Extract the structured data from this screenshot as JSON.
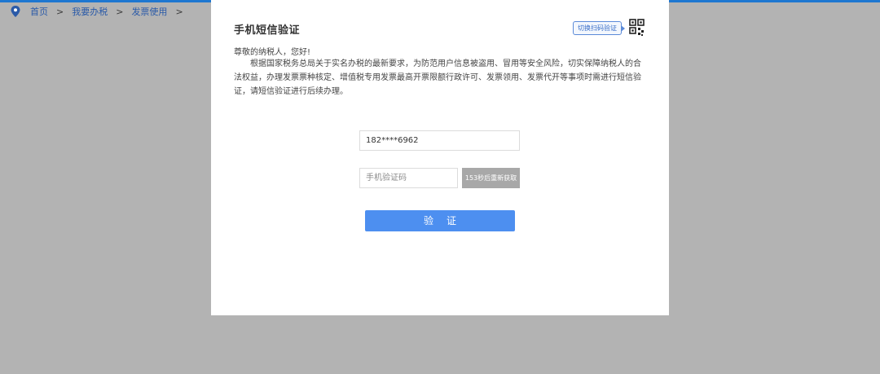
{
  "breadcrumb": {
    "items": [
      "首页",
      "我要办税",
      "发票使用"
    ],
    "separator": ">"
  },
  "modal": {
    "title": "手机短信验证",
    "switch_label": "切换扫码验证",
    "greeting": "尊敬的纳税人，您好!",
    "notice": "根据国家税务总局关于实名办税的最新要求，为防范用户信息被盗用、冒用等安全风险，切实保障纳税人的合法权益，办理发票票种核定、增值税专用发票最高开票限额行政许可、发票领用、发票代开等事项时需进行短信验证，请短信验证进行后续办理。",
    "phone_value": "182****6962",
    "code_placeholder": "手机验证码",
    "resend_label": "153秒后重新获取",
    "verify_label": "验证"
  },
  "colors": {
    "accent": "#4d8ff0",
    "overlay": "#b3b3b3",
    "disabled_button": "#a8a8a8"
  }
}
